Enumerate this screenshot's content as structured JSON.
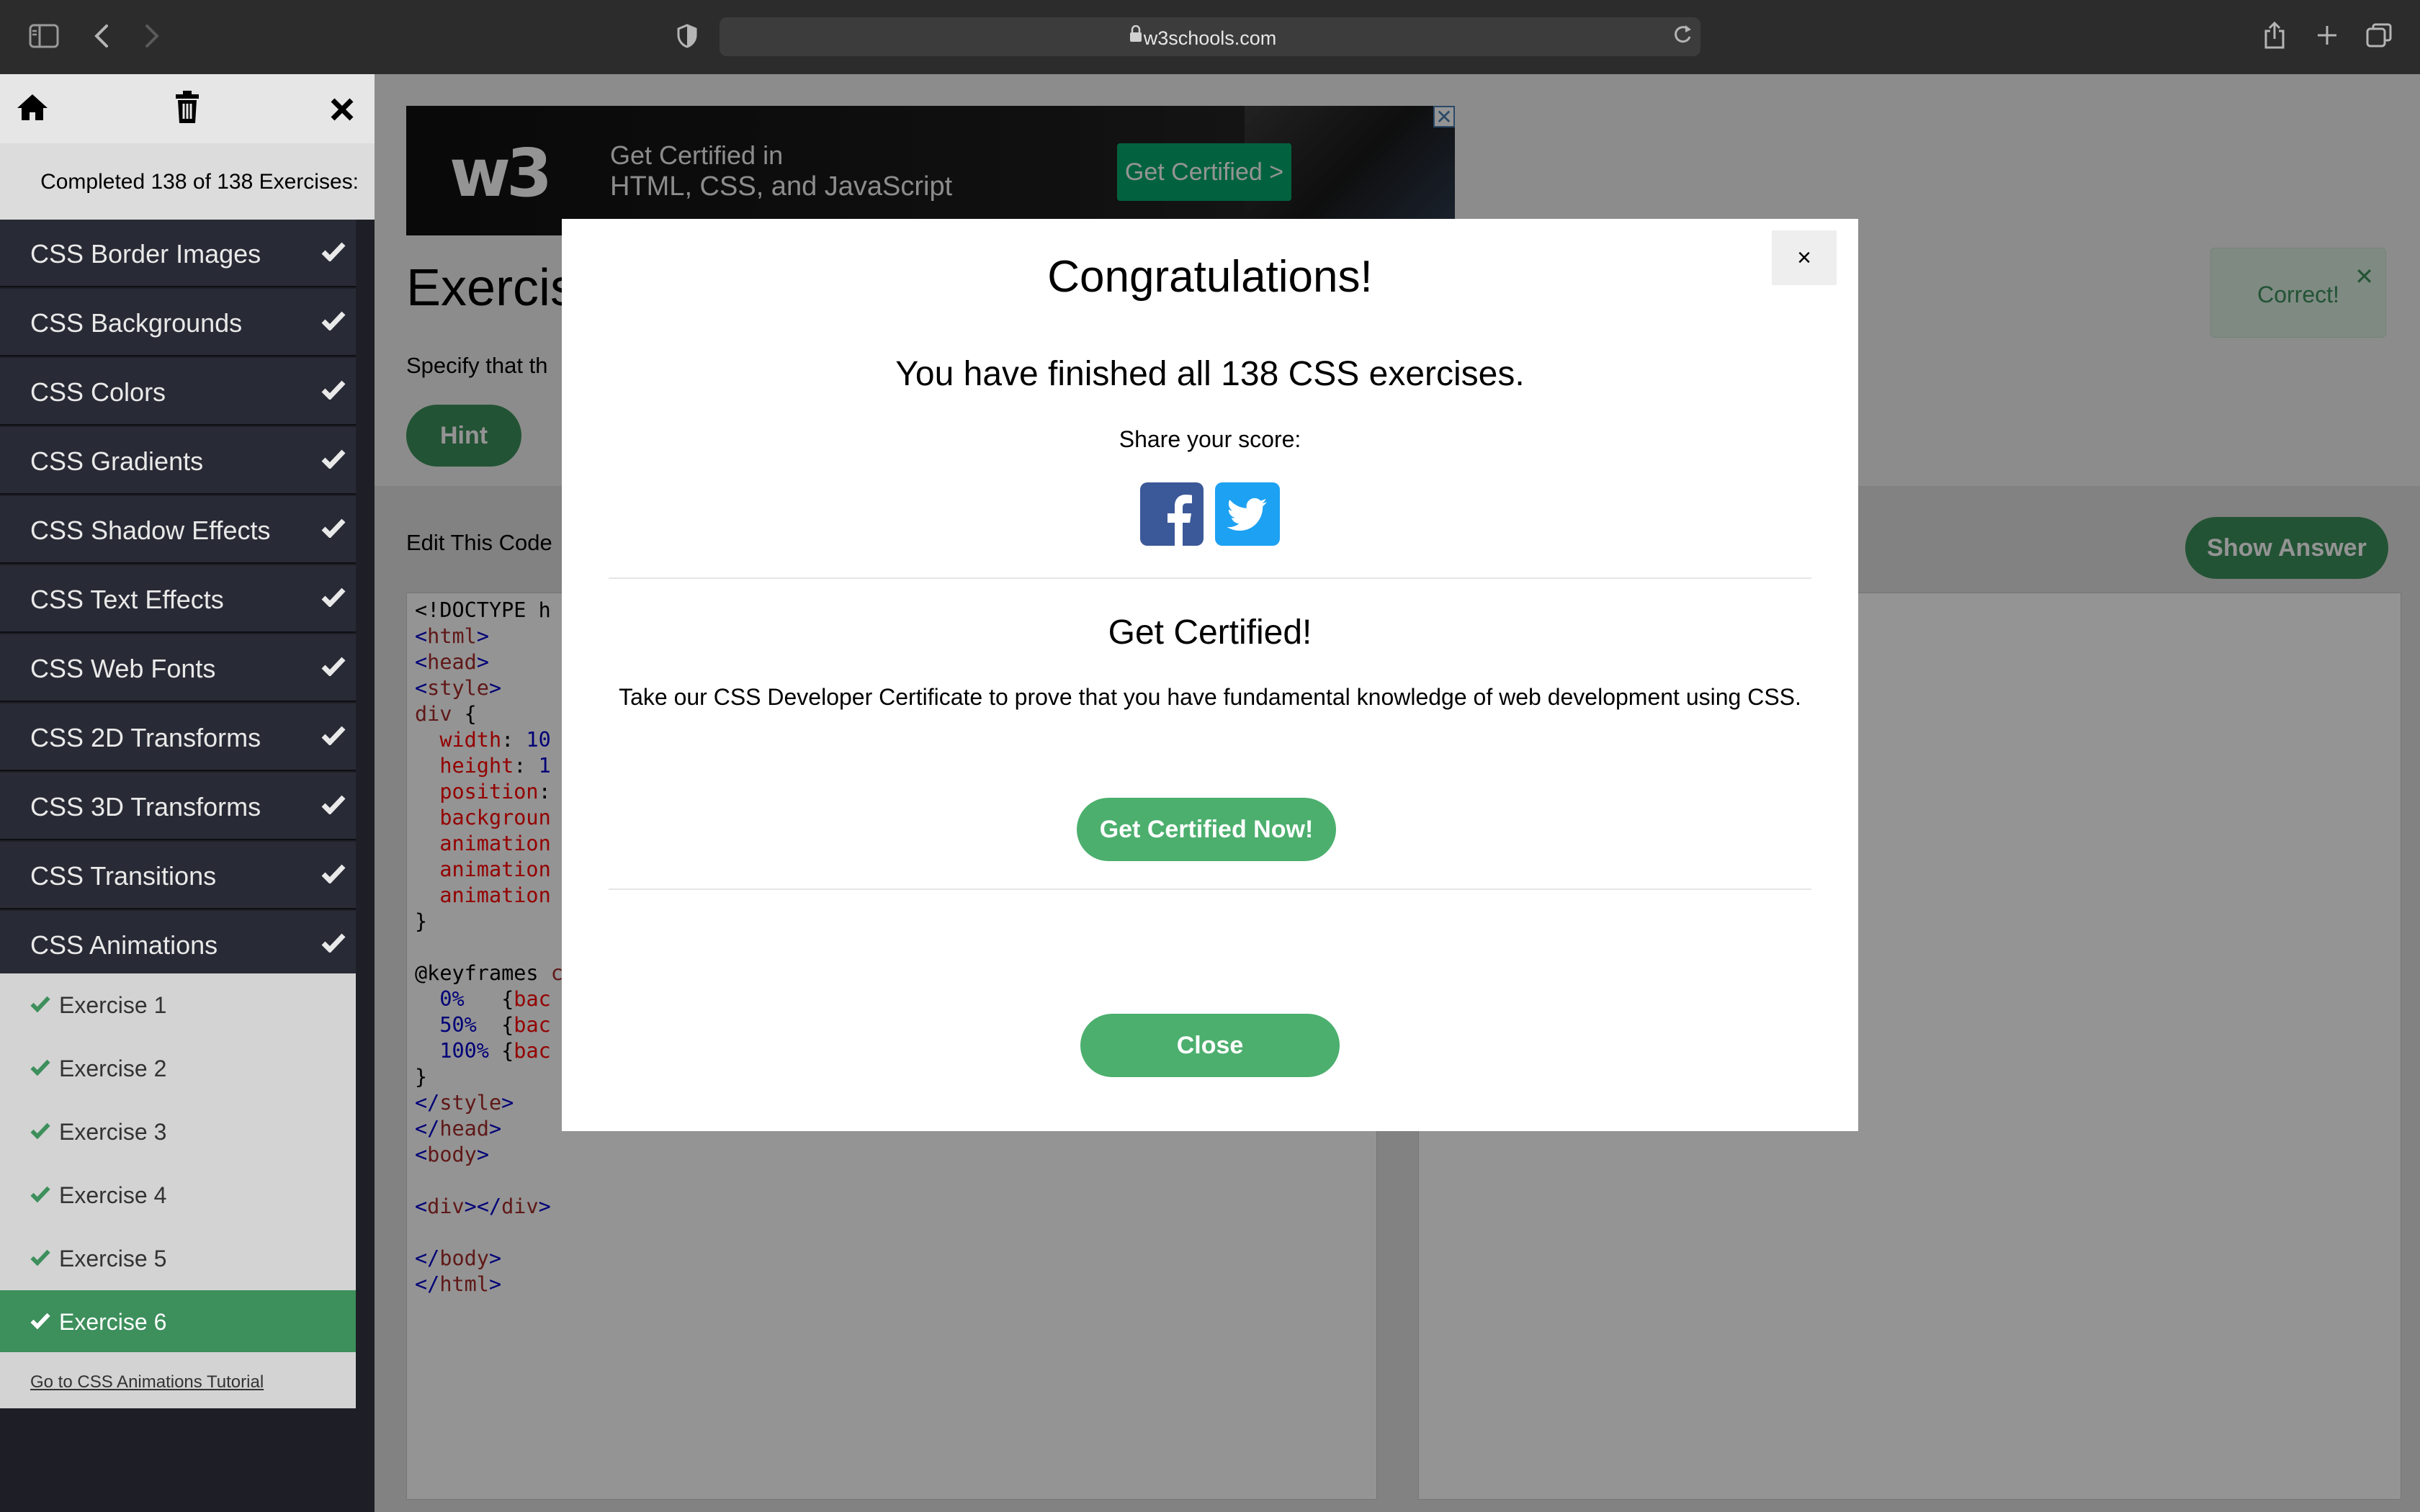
{
  "browser": {
    "url": "w3schools.com"
  },
  "sidebar": {
    "status": "Completed 138 of 138 Exercises:",
    "categories": [
      {
        "label": "CSS Border Images"
      },
      {
        "label": "CSS Backgrounds"
      },
      {
        "label": "CSS Colors"
      },
      {
        "label": "CSS Gradients"
      },
      {
        "label": "CSS Shadow Effects"
      },
      {
        "label": "CSS Text Effects"
      },
      {
        "label": "CSS Web Fonts"
      },
      {
        "label": "CSS 2D Transforms"
      },
      {
        "label": "CSS 3D Transforms"
      },
      {
        "label": "CSS Transitions"
      },
      {
        "label": "CSS Animations"
      }
    ],
    "exercises": [
      {
        "label": "Exercise 1"
      },
      {
        "label": "Exercise 2"
      },
      {
        "label": "Exercise 3"
      },
      {
        "label": "Exercise 4"
      },
      {
        "label": "Exercise 5"
      },
      {
        "label": "Exercise 6"
      }
    ],
    "tutorial_link": "Go to CSS Animations Tutorial"
  },
  "ad": {
    "logo": "w3",
    "line1": "Get Certified in",
    "line2": "HTML, CSS, and JavaScript",
    "button": "Get Certified >",
    "close": "✕"
  },
  "main": {
    "title": "Exercis",
    "instruction": "Specify that th",
    "hint": "Hint",
    "edit_label": "Edit This Code",
    "show_answer": "Show Answer",
    "toast": "Correct!",
    "toast_close": "✕"
  },
  "modal": {
    "close_x": "×",
    "title": "Congratulations!",
    "finished": "You have finished all 138 CSS exercises.",
    "share": "Share your score:",
    "certified_title": "Get Certified!",
    "certified_text": "Take our CSS Developer Certificate to prove that you have fundamental knowledge of web development using CSS.",
    "certified_button": "Get Certified Now!",
    "close_button": "Close"
  },
  "colors": {
    "sidebar_bg": "#282a35",
    "accent_green": "#4caf6e",
    "active_green": "#3d8f5c",
    "facebook": "#3b5998",
    "twitter": "#1da1f2"
  }
}
